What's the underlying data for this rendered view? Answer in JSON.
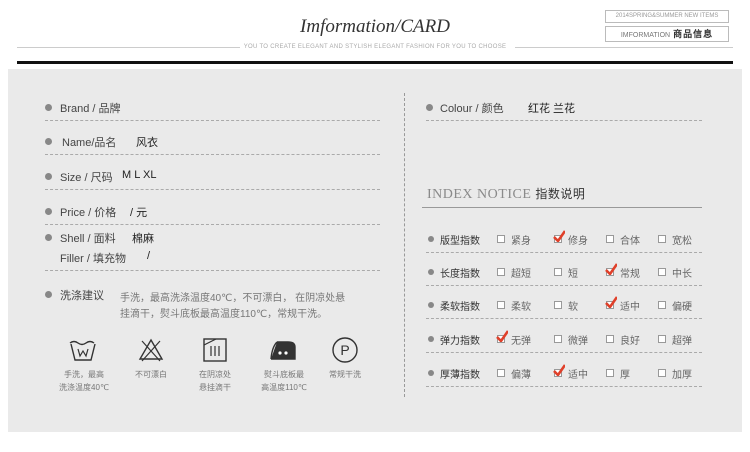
{
  "header": {
    "title": "Imformation/CARD",
    "subtitle": "YOU TO CREATE ELEGANT AND STYLISH ELEGANT FASHION FOR YOU TO CHOOSE",
    "badge_top": "2014SPRING&SUMMER NEW ITEMS",
    "badge_bottom_en": "IMFORMATION",
    "badge_bottom_cn": "商品信息"
  },
  "info": {
    "brand_label": "Brand",
    "brand_cn": "品牌",
    "name_label": "Name",
    "name_cn": "品名",
    "name_value": "风衣",
    "size_label": "Size",
    "size_cn": "尺码",
    "size_value": "M L XL",
    "price_label": "Price",
    "price_cn": "价格",
    "price_value": "/ 元",
    "shell_label": "Shell",
    "shell_cn": "面料",
    "shell_value": "棉麻",
    "filler_label": "Filler",
    "filler_cn": "填充物",
    "filler_value": "/",
    "wash_label": "洗涤建议",
    "wash_text_1": "手洗，最高洗涤温度40℃，不可漂白， 在阴凉处悬",
    "wash_text_2": "挂滴干，熨斗底板最高温度110℃，常规干洗。",
    "colour_label": "Colour",
    "colour_cn": "颜色",
    "colour_value": "红花 兰花"
  },
  "care": [
    {
      "icon": "wash-tub-icon",
      "l1": "手洗，最高",
      "l2": "洗涤温度40℃"
    },
    {
      "icon": "no-bleach-icon",
      "l1": "不可漂白",
      "l2": ""
    },
    {
      "icon": "line-dry-shade-icon",
      "l1": "在阴凉处",
      "l2": "悬挂滴干"
    },
    {
      "icon": "iron-icon",
      "l1": "熨斗底板最",
      "l2": "高温度110℃"
    },
    {
      "icon": "dry-clean-p-icon",
      "l1": "常规干洗",
      "l2": ""
    }
  ],
  "care_symbol": "P",
  "index": {
    "title_en": "INDEX NOTICE",
    "title_cn": "指数说明",
    "rows": [
      {
        "label": "版型指数",
        "options": [
          "紧身",
          "修身",
          "合体",
          "宽松"
        ],
        "checked": 1
      },
      {
        "label": "长度指数",
        "options": [
          "超短",
          "短",
          "常规",
          "中长"
        ],
        "checked": 2
      },
      {
        "label": "柔软指数",
        "options": [
          "柔软",
          "软",
          "适中",
          "偏硬"
        ],
        "checked": 2
      },
      {
        "label": "弹力指数",
        "options": [
          "无弹",
          "微弹",
          "良好",
          "超弹"
        ],
        "checked": 0
      },
      {
        "label": "厚薄指数",
        "options": [
          "偏薄",
          "适中",
          "厚",
          "加厚"
        ],
        "checked": 1
      }
    ]
  },
  "colors": {
    "accent_check": "#e0402a",
    "panel_bg": "#eaeaea"
  }
}
